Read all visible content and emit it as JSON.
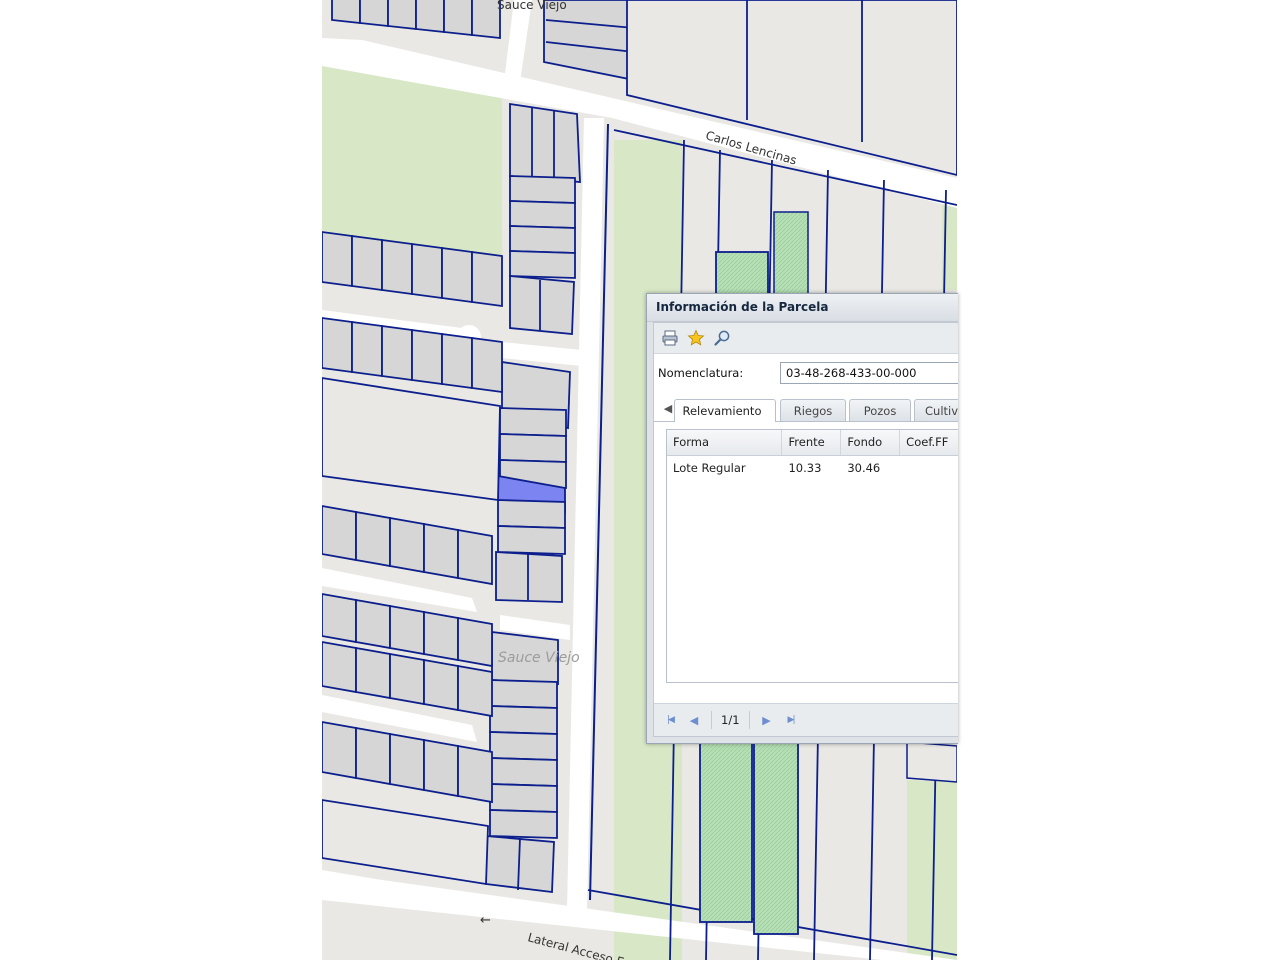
{
  "map": {
    "streets": {
      "top": "Sauce Viejo",
      "carlos": "Carlos Lencinas",
      "lateral": "Lateral Acceso Este",
      "lateral_arrow": "←"
    },
    "place": "Sauce Viejo",
    "colors": {
      "background": "#e9e8e4",
      "parcel": "#d6d6d6",
      "parcel_border": "#0c1f8c",
      "selected": "#7b84f0",
      "green": "#d8e8c6",
      "hatched": "#b7e0b7",
      "road": "#ffffff"
    }
  },
  "window": {
    "title": "Información de la Parcela",
    "toolbar": {
      "print": "print-icon",
      "favorite": "star-icon",
      "zoom": "magnifier-icon"
    },
    "nomenclatura_label": "Nomenclatura:",
    "nomenclatura_value": "03-48-268-433-00-000",
    "tab_scroll": "◀",
    "tabs": [
      "Relevamiento",
      "Riegos",
      "Pozos",
      "Cultiv"
    ],
    "grid": {
      "headers": [
        "Forma",
        "Frente",
        "Fondo",
        "Coef.FF"
      ],
      "rows": [
        [
          "Lote Regular",
          "10.33",
          "30.46",
          ""
        ]
      ]
    },
    "pager": {
      "first": "|◀",
      "prev": "◀",
      "page": "1/1",
      "next": "▶",
      "last": "▶|"
    }
  }
}
